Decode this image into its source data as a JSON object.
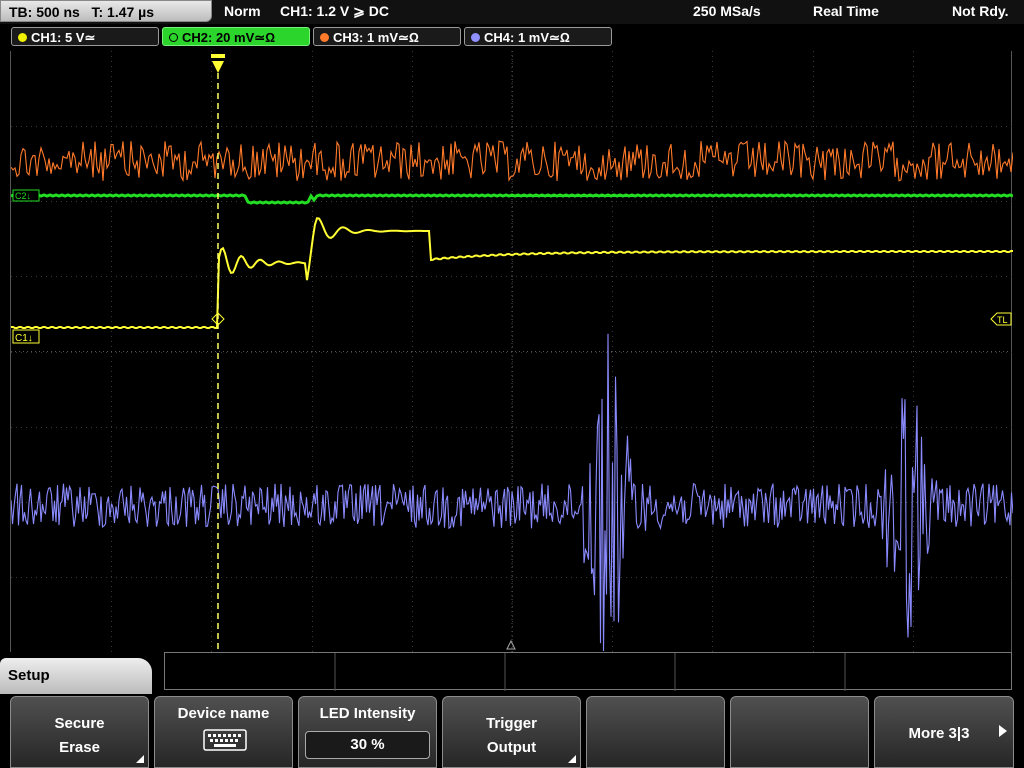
{
  "status": {
    "timebase": "TB: 500 ns",
    "trigger_time": "T: 1.47 µs",
    "mode": "Norm",
    "trigger": "CH1: 1.2 V ⩾ DC",
    "sample_rate": "250 MSa/s",
    "acq": "Real Time",
    "state": "Not Rdy."
  },
  "channels": [
    {
      "label": "CH1: 5 V≃",
      "color": "#f0f000",
      "active": false
    },
    {
      "label": "CH2: 20 mV≃Ω",
      "color": "#2bd52b",
      "active": true
    },
    {
      "label": "CH3: 1 mV≃Ω",
      "color": "#ff7a2a",
      "active": false
    },
    {
      "label": "CH4: 1 mV≃Ω",
      "color": "#9090ff",
      "active": false
    }
  ],
  "markers": {
    "ch1": "C1↓",
    "ch2": "C2↓",
    "tl": "TL"
  },
  "colors": {
    "ch1": "#ffff33",
    "ch2": "#22dd22",
    "ch3": "#ff7a2a",
    "ch4": "#8a8aff",
    "grid": "#3a3a3a",
    "trigger": "#ffff66"
  },
  "menu": {
    "title": "Setup",
    "softkeys": [
      {
        "line1": "Secure",
        "line2": "Erase",
        "type": "corner"
      },
      {
        "line1": "Device name",
        "line2": "",
        "type": "keyboard"
      },
      {
        "line1": "LED Intensity",
        "value": "30 %",
        "type": "value"
      },
      {
        "line1": "Trigger",
        "line2": "Output",
        "type": "corner"
      },
      {
        "line1": "",
        "line2": "",
        "type": "blank"
      },
      {
        "line1": "",
        "line2": "",
        "type": "blank"
      },
      {
        "line1": "More 3|3",
        "line2": "",
        "type": "more"
      }
    ]
  }
}
